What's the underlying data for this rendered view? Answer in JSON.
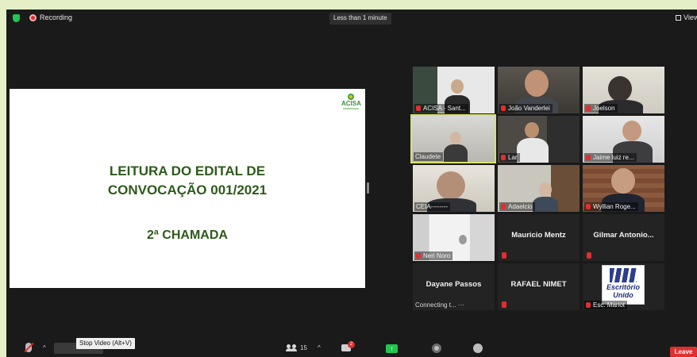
{
  "topbar": {
    "recording_label": "Recording",
    "timer": "Less than 1 minute",
    "view_label": "View"
  },
  "slide": {
    "logo_text": "ACISA",
    "title_line1": "LEITURA DO EDITAL DE",
    "title_line2": "CONVOCAÇÃO 001/2021",
    "subtitle": "2ª CHAMADA"
  },
  "gallery": {
    "acisa": "ACISA - Sant...",
    "joao": "João Vanderlei",
    "joelson": "Joelson",
    "claudete": "Claudete",
    "lar": "Lar",
    "jaime": "Jaime luiz re...",
    "ceia": "CEIA--------",
    "adaelcio": "Adaelcio",
    "wyllian": "Wyllian Roge...",
    "neri": "Neri Noro",
    "mauricio": "Mauricio Mentz",
    "gilmar": "Gilmar Antonio...",
    "dayane": "Dayane Passos",
    "connecting": "Connecting t... ···",
    "rafael": "RAFAEL NIMET",
    "escritorio_logo_line1": "Escritório",
    "escritorio_logo_line2": "Unido",
    "escritorio": "Esc. Mariot"
  },
  "toolbar": {
    "tooltip": "Stop Video (Alt+V)",
    "participants_count": "15",
    "chat_badge": "2",
    "share_arrow": "↑",
    "leave_label": "Leave"
  },
  "colors": {
    "accent_green": "#23c552",
    "recording_red": "#e02f2f",
    "slide_text": "#2e5a1c",
    "active_speaker": "#d8e06a"
  }
}
